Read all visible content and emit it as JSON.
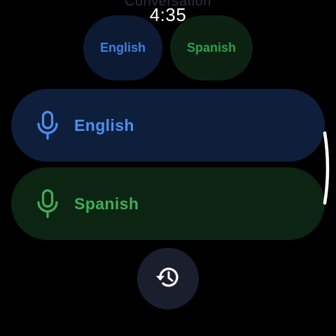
{
  "header": {
    "title": "Conversation",
    "time": "4:35"
  },
  "chips": {
    "first_language": "English",
    "second_language": "Spanish"
  },
  "buttons": {
    "english_label": "English",
    "spanish_label": "Spanish"
  },
  "colors": {
    "english_accent": "#4d8ff0",
    "spanish_accent": "#3dae57",
    "english_bg": "#0e1f3c",
    "spanish_bg": "#0c2412",
    "history_bg": "#1a1f2e"
  },
  "icons": {
    "english_mic": "mic-icon",
    "spanish_mic": "mic-icon",
    "history": "history-icon"
  }
}
